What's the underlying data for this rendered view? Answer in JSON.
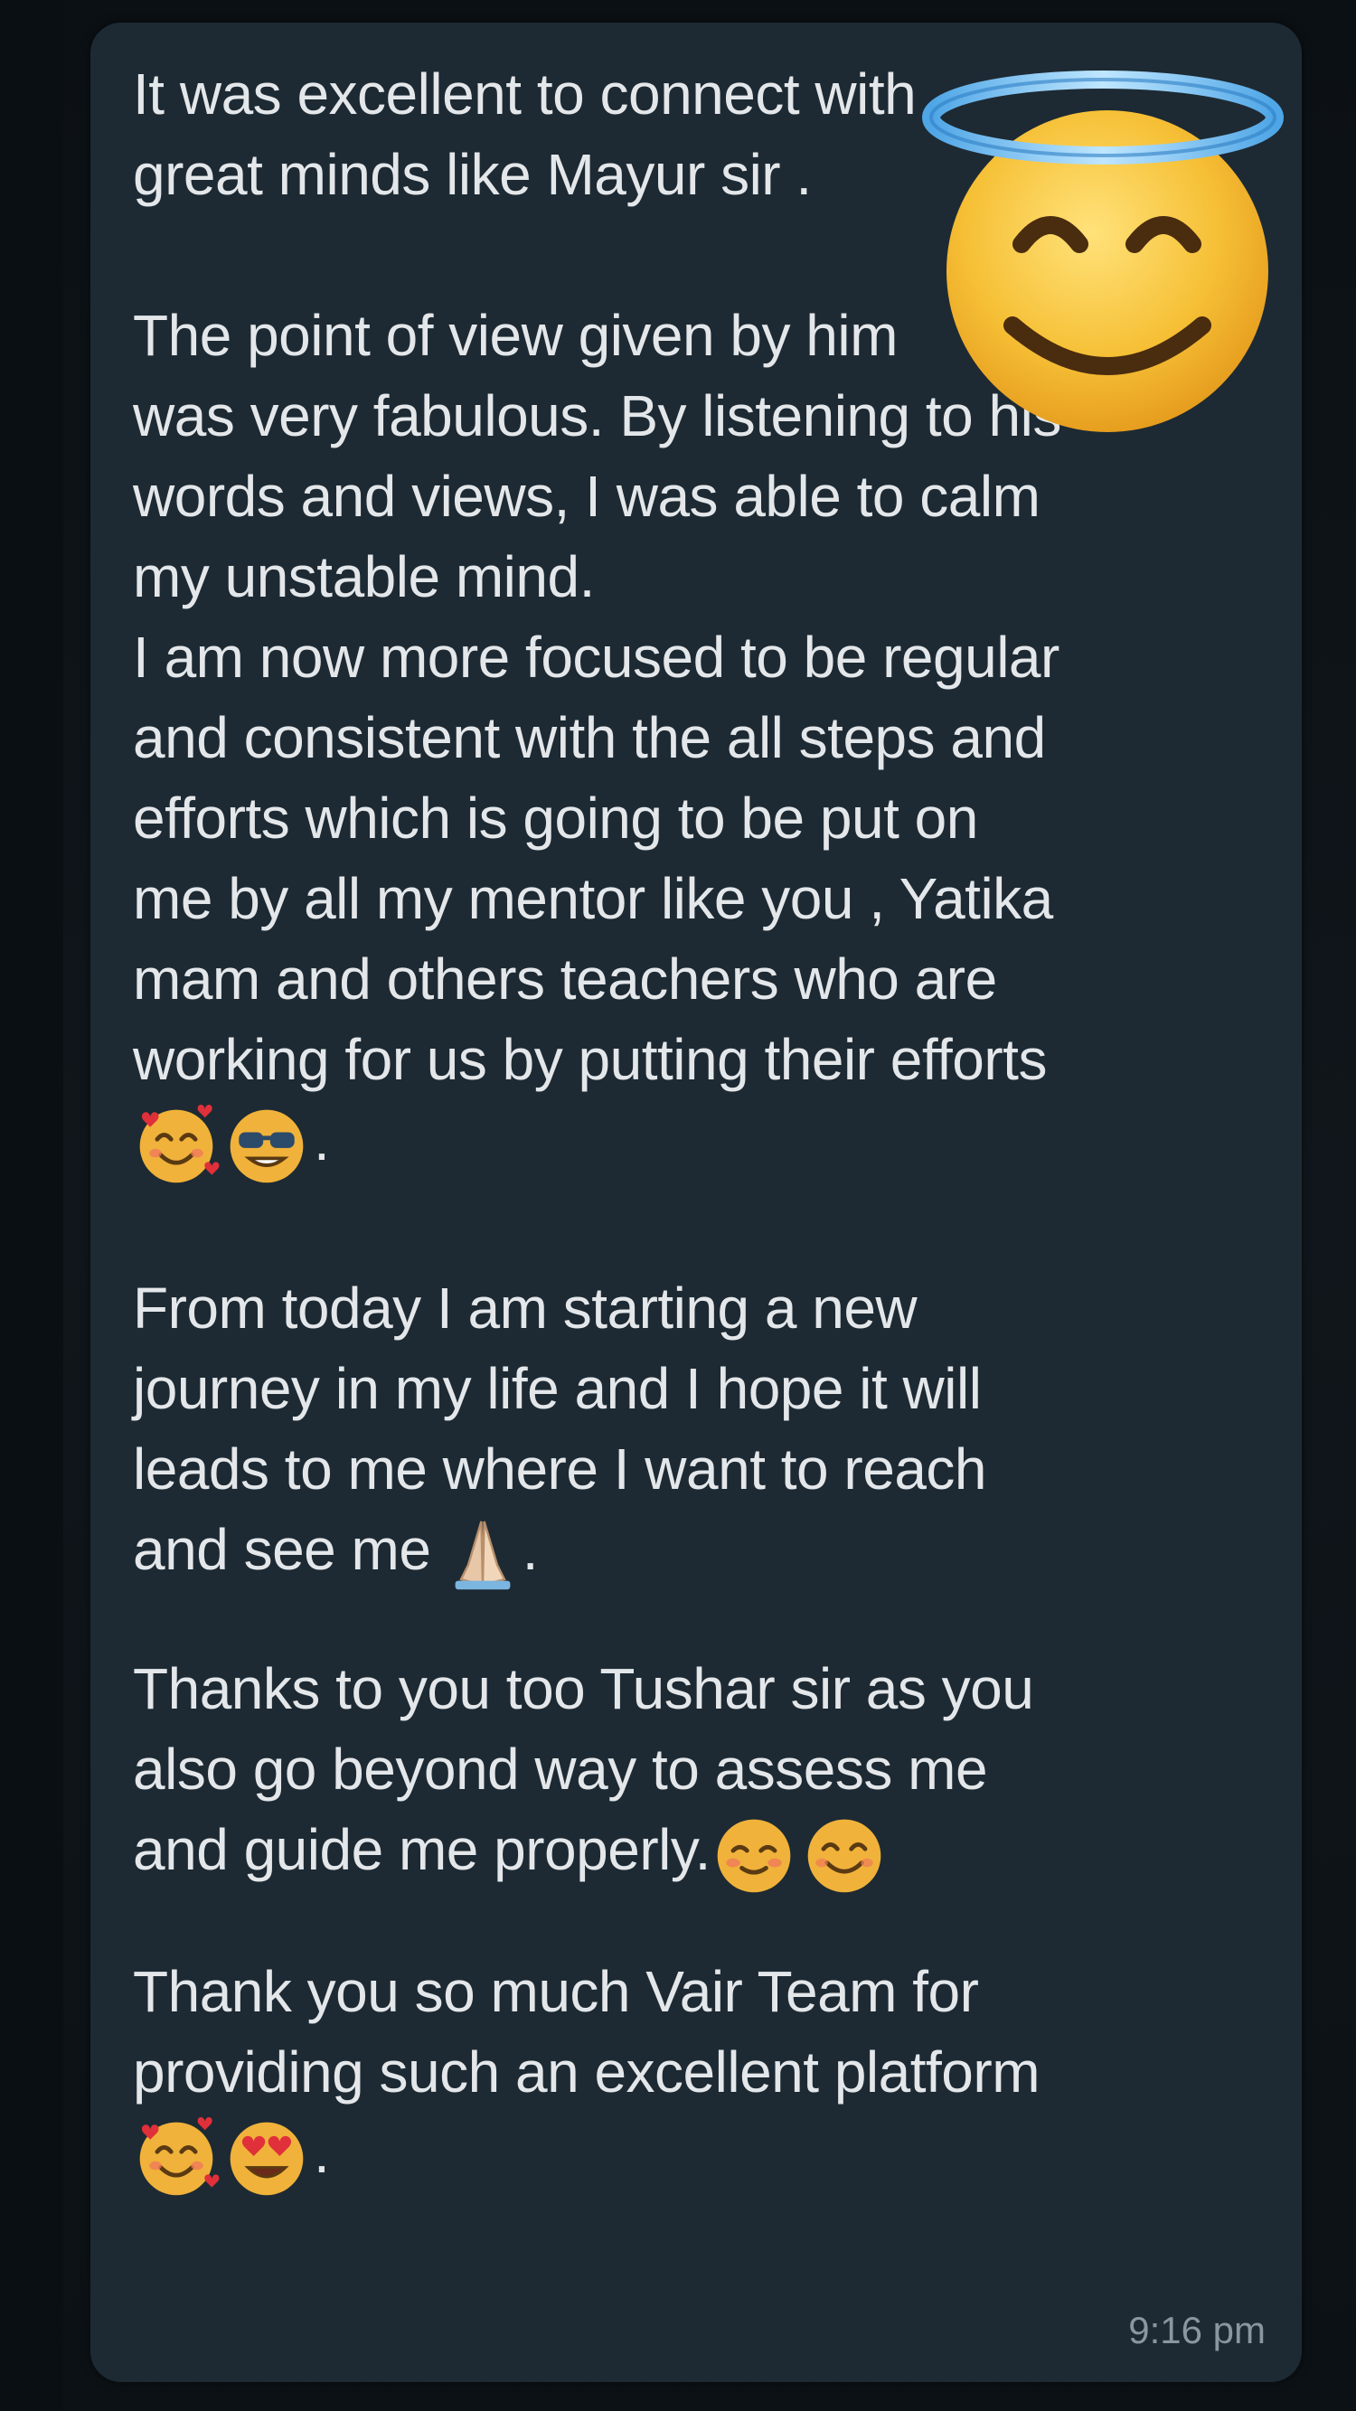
{
  "chat": {
    "paragraph1": [
      "It was excellent to connect with",
      "great minds like Mayur sir ."
    ],
    "paragraph2": [
      "The point of view given by him",
      "was very fabulous. By listening to his",
      "words and views, I was able to calm",
      "my unstable mind.",
      "I am now more focused to be regular",
      "and consistent with the all steps and",
      "efforts which is going to be put on",
      "me by all my mentor like you , Yatika",
      "mam and others teachers who are",
      "working for us by putting their efforts"
    ],
    "paragraph2_end": ".",
    "paragraph3": [
      "From today I am starting a new",
      "journey in my life and I hope it will",
      "leads to me where I want to reach"
    ],
    "paragraph3_last": "and see me",
    "paragraph3_end": ".",
    "paragraph4": [
      "Thanks to you too Tushar sir as you",
      "also go beyond way to assess me"
    ],
    "paragraph4_last": "and guide me properly.",
    "paragraph5": [
      "Thank you so much Vair Team for",
      "providing such an excellent platform"
    ],
    "paragraph5_end": ".",
    "timestamp": "9:16 pm"
  },
  "icons": {
    "overlay": "smiling-face-with-halo-icon",
    "p2_emojis": [
      "smiling-face-with-hearts-icon",
      "smiling-face-with-sunglasses-icon"
    ],
    "p3_emoji": "folded-hands-icon",
    "p4_emojis": [
      "smiling-blush-icon",
      "smiling-face-icon"
    ],
    "p5_emojis": [
      "smiling-face-with-hearts-icon",
      "heart-eyes-icon"
    ]
  },
  "colors": {
    "background": "#0d1216",
    "bubble": "#1d2a33",
    "text": "#e4e7ea",
    "timestamp": "#8b969e",
    "emoji_yellow": "#f5c242"
  }
}
